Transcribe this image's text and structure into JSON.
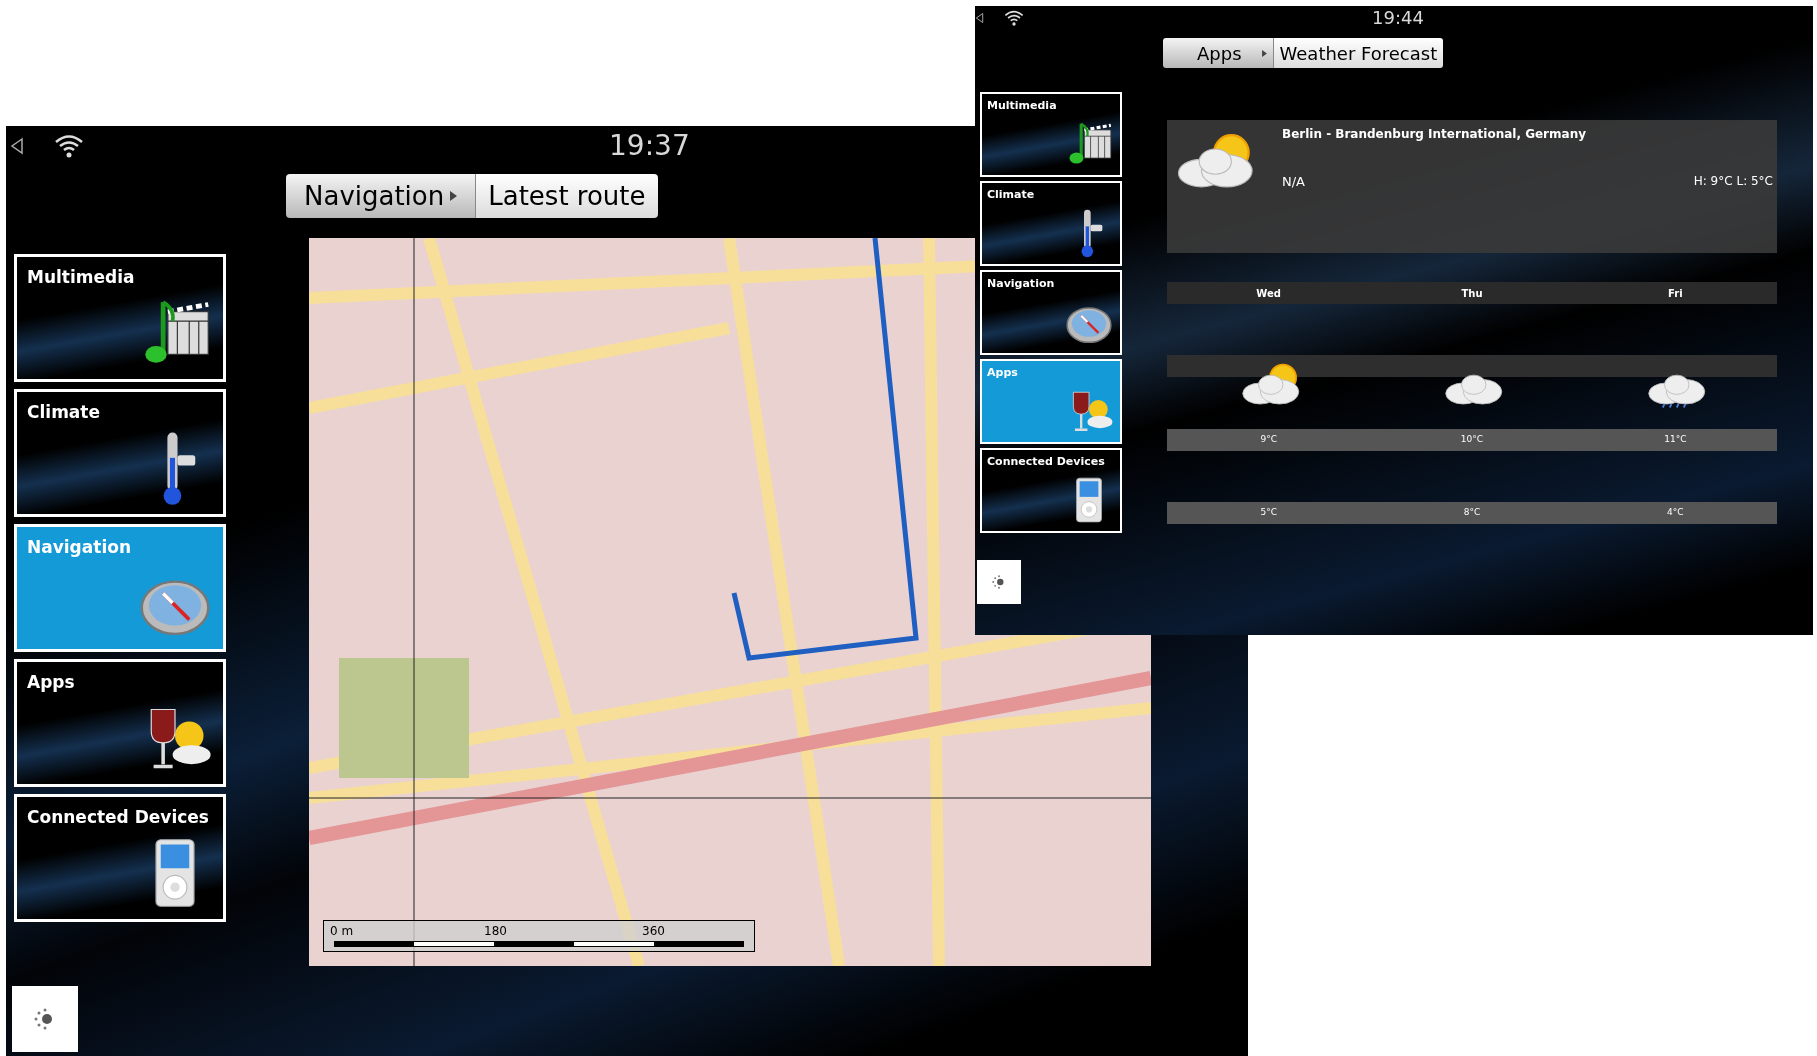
{
  "windows": [
    {
      "kind": "large",
      "time": "19:37",
      "breadcrumb": [
        {
          "label": "Navigation"
        },
        {
          "label": "Latest route"
        }
      ],
      "menu": [
        {
          "label": "Multimedia",
          "selected": false
        },
        {
          "label": "Climate",
          "selected": false
        },
        {
          "label": "Navigation",
          "selected": true
        },
        {
          "label": "Apps",
          "selected": false
        },
        {
          "label": "Connected Devices",
          "selected": false
        }
      ],
      "map": {
        "scale_labels": [
          "0 m",
          "180",
          "360"
        ]
      }
    },
    {
      "kind": "small",
      "time": "19:44",
      "breadcrumb": [
        {
          "label": "Apps"
        },
        {
          "label": "Weather Forecast"
        }
      ],
      "menu": [
        {
          "label": "Multimedia",
          "selected": false
        },
        {
          "label": "Climate",
          "selected": false
        },
        {
          "label": "Navigation",
          "selected": false
        },
        {
          "label": "Apps",
          "selected": true
        },
        {
          "label": "Connected Devices",
          "selected": false
        }
      ],
      "weather": {
        "location": "Berlin - Brandenburg International, Germany",
        "condition": "N/A",
        "high_low": "H: 9°C L: 5°C",
        "days": [
          {
            "day": "Wed",
            "high": "9°C",
            "low": "5°C"
          },
          {
            "day": "Thu",
            "high": "10°C",
            "low": "8°C"
          },
          {
            "day": "Fri",
            "high": "11°C",
            "low": "4°C"
          }
        ]
      }
    }
  ]
}
